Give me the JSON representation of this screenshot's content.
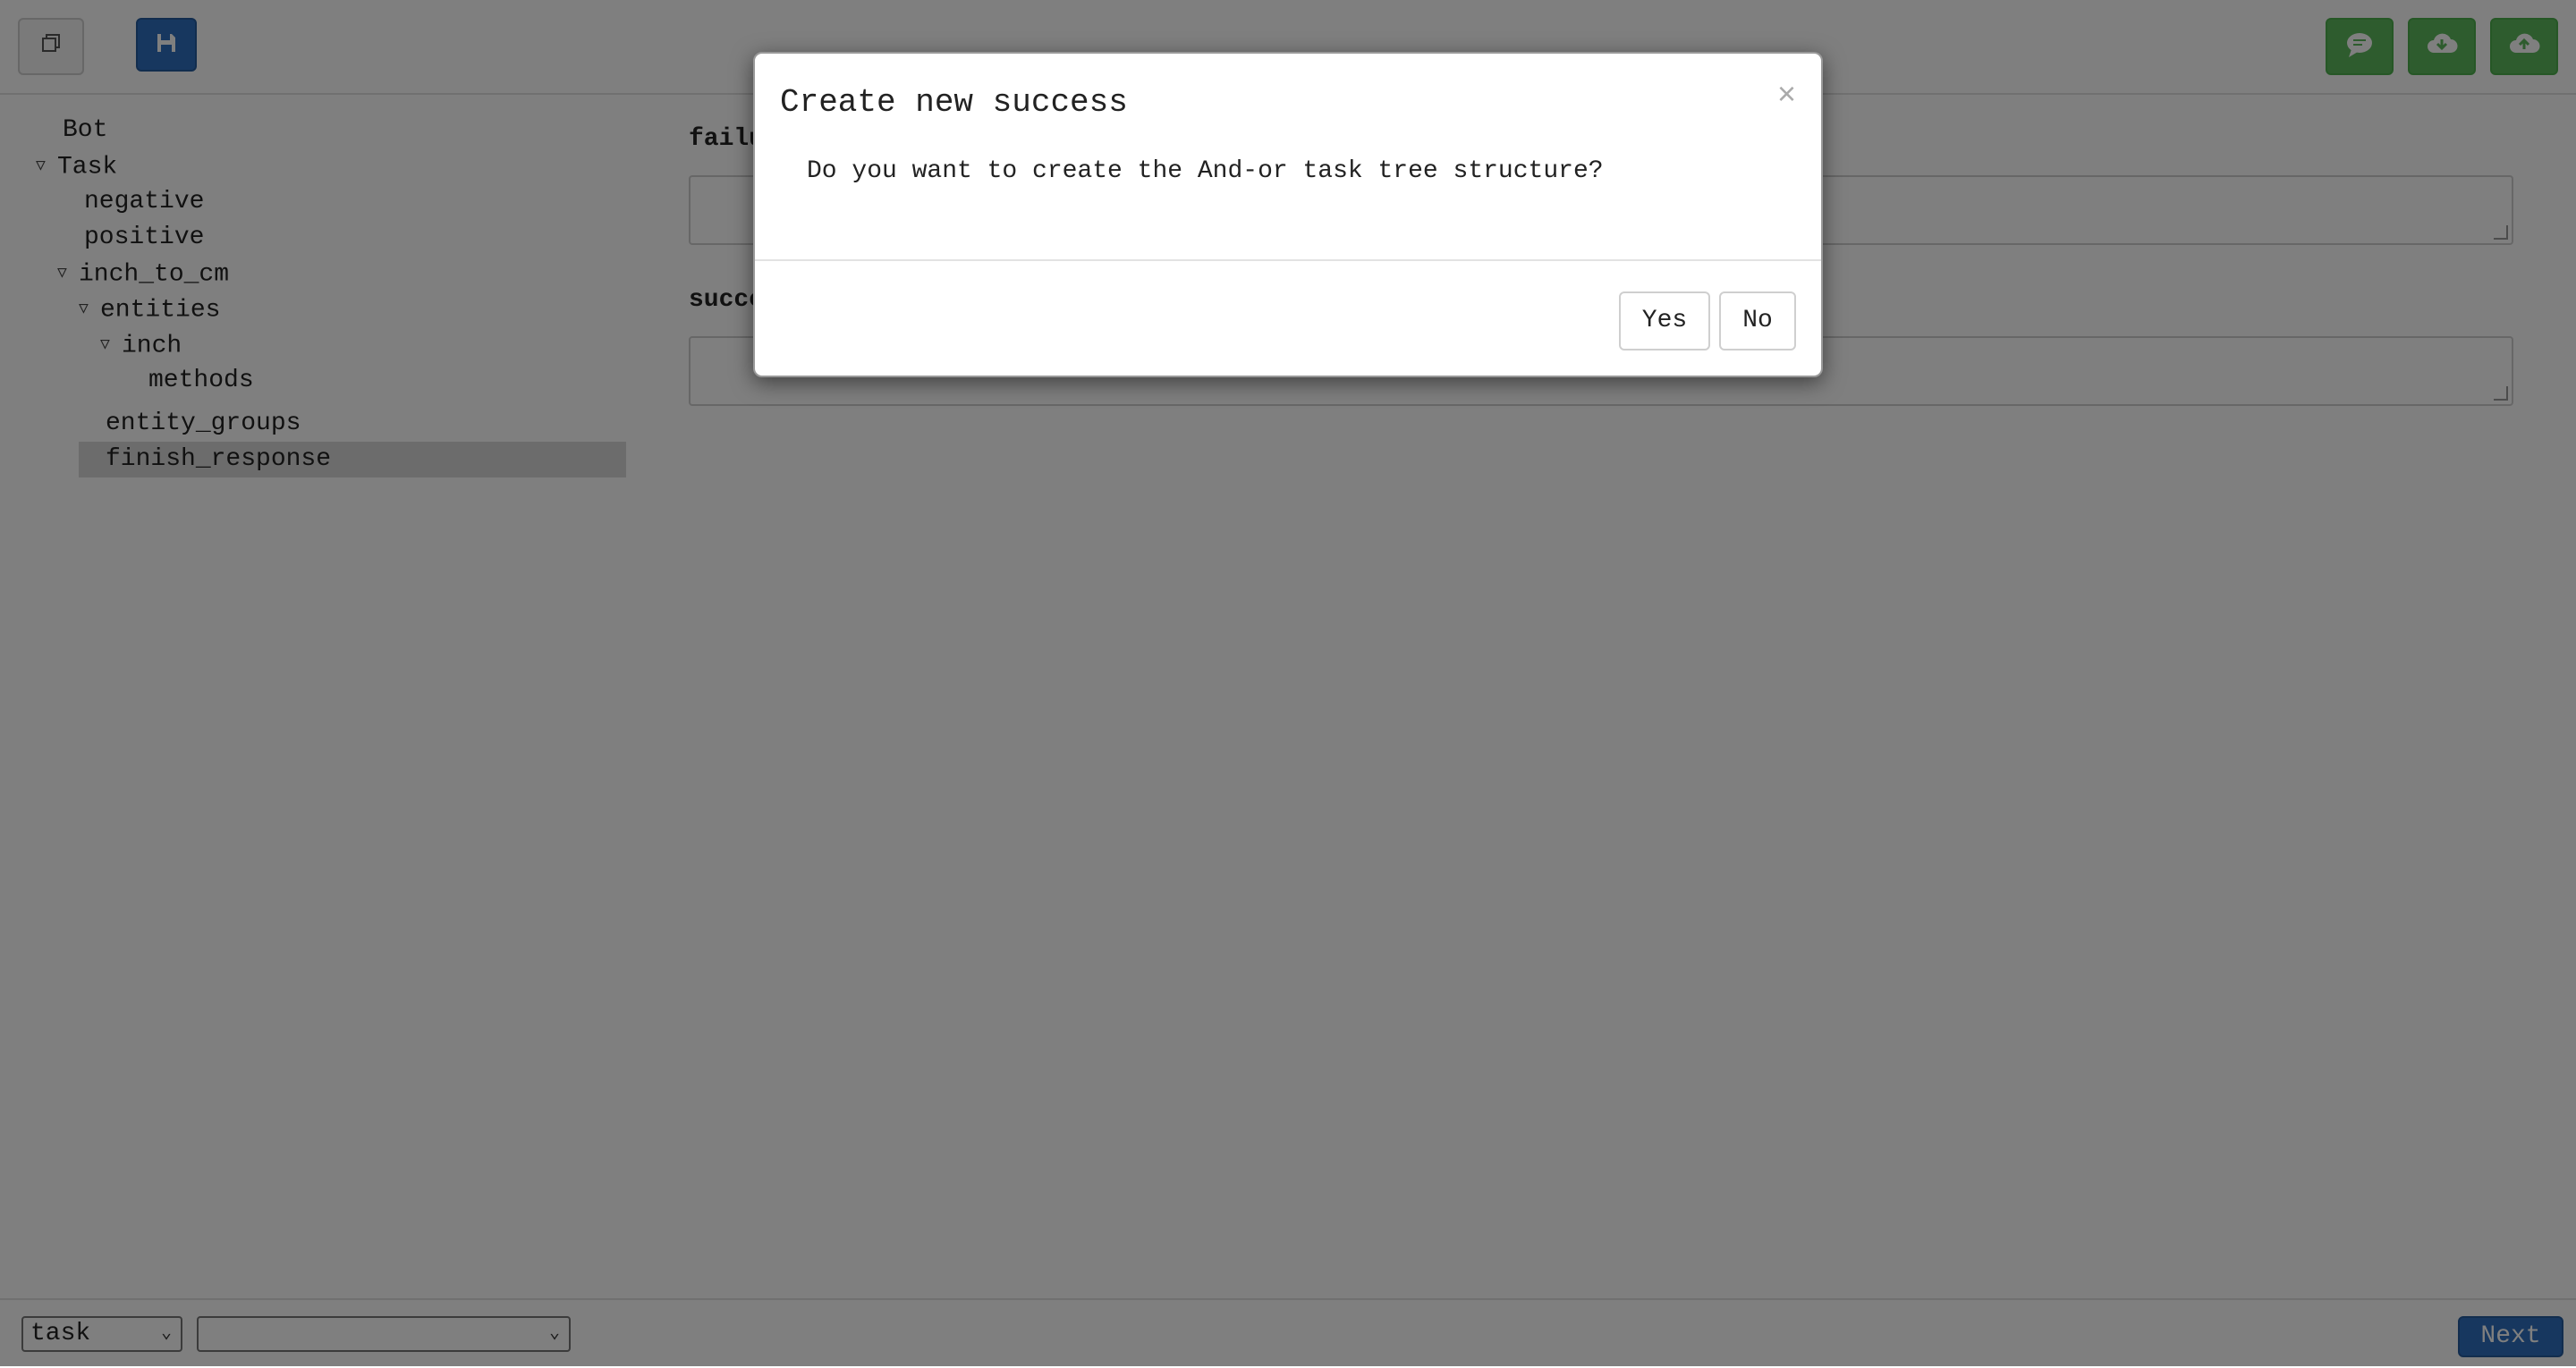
{
  "toolbar": {
    "copy_icon": "copy-icon",
    "save_icon": "floppy-disk-icon",
    "chat_icon": "chat-bubble-icon",
    "download_icon": "cloud-download-icon",
    "upload_icon": "cloud-upload-icon",
    "colors": {
      "save": "#2f6fbf",
      "green": "#5cb85c"
    }
  },
  "tree": {
    "items": [
      {
        "label": "Bot",
        "expanded": null
      },
      {
        "label": "Task",
        "expanded": true
      },
      {
        "label": "negative",
        "expanded": null
      },
      {
        "label": "positive",
        "expanded": null
      },
      {
        "label": "inch_to_cm",
        "expanded": true
      },
      {
        "label": "entities",
        "expanded": true
      },
      {
        "label": "inch",
        "expanded": true
      },
      {
        "label": "methods",
        "expanded": null
      },
      {
        "label": "entity_groups",
        "expanded": null
      },
      {
        "label": "finish_response",
        "expanded": null,
        "selected": true
      }
    ]
  },
  "fields": {
    "failure_label": "failure",
    "success_label": "success"
  },
  "bottom": {
    "type_select_value": "task",
    "second_select_value": "",
    "next_label": "Next"
  },
  "modal": {
    "title": "Create new success",
    "close_glyph": "×",
    "body": "Do you want to create the And-or task tree structure?",
    "yes_label": "Yes",
    "no_label": "No"
  }
}
